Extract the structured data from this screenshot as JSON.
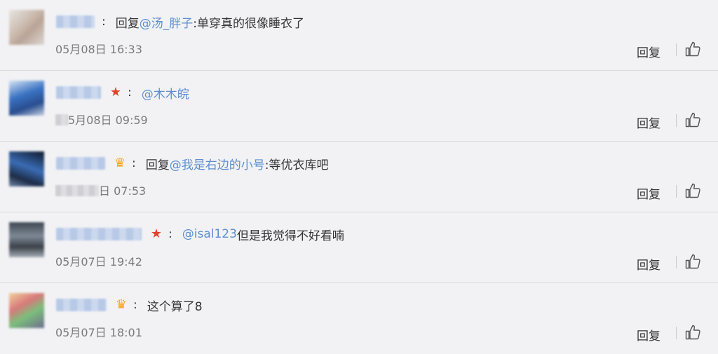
{
  "comments": [
    {
      "time_suffix": "05月08日 16:33",
      "time_blur_prefix": false,
      "badge": "",
      "parts": [
        {
          "t": "回复",
          "m": false
        },
        {
          "t": "@汤_胖子",
          "m": true
        },
        {
          "t": ":单穿真的很像睡衣了",
          "m": false
        }
      ],
      "reply_label": "回复"
    },
    {
      "time_suffix": "5月08日 09:59",
      "time_blur_prefix": true,
      "badge": "star",
      "parts": [
        {
          "t": "@木木皖",
          "m": true
        }
      ],
      "reply_label": "回复"
    },
    {
      "time_suffix": "日 07:53",
      "time_blur_prefix": true,
      "badge": "crown",
      "parts": [
        {
          "t": "回复",
          "m": false
        },
        {
          "t": "@我是右边的小号",
          "m": true
        },
        {
          "t": ":等优衣库吧",
          "m": false
        }
      ],
      "reply_label": "回复"
    },
    {
      "time_suffix": "05月07日 19:42",
      "time_blur_prefix": false,
      "badge": "star",
      "parts": [
        {
          "t": "@isal123",
          "m": true
        },
        {
          "t": " 但是我觉得不好看喃",
          "m": false
        }
      ],
      "reply_label": "回复"
    },
    {
      "time_suffix": "05月07日 18:01",
      "time_blur_prefix": false,
      "badge": "crown",
      "parts": [
        {
          "t": "这个算了8",
          "m": false
        }
      ],
      "reply_label": "回复"
    }
  ],
  "colon": ":",
  "colors": {
    "mention": "#5b8fcf",
    "star_badge": "#e0432b",
    "crown_badge": "#f2a417",
    "background": "#f2f2f5"
  },
  "icons": {
    "star_badge": "star-badge-icon",
    "crown_badge": "crown-badge-icon",
    "like": "thumbs-up-icon"
  }
}
